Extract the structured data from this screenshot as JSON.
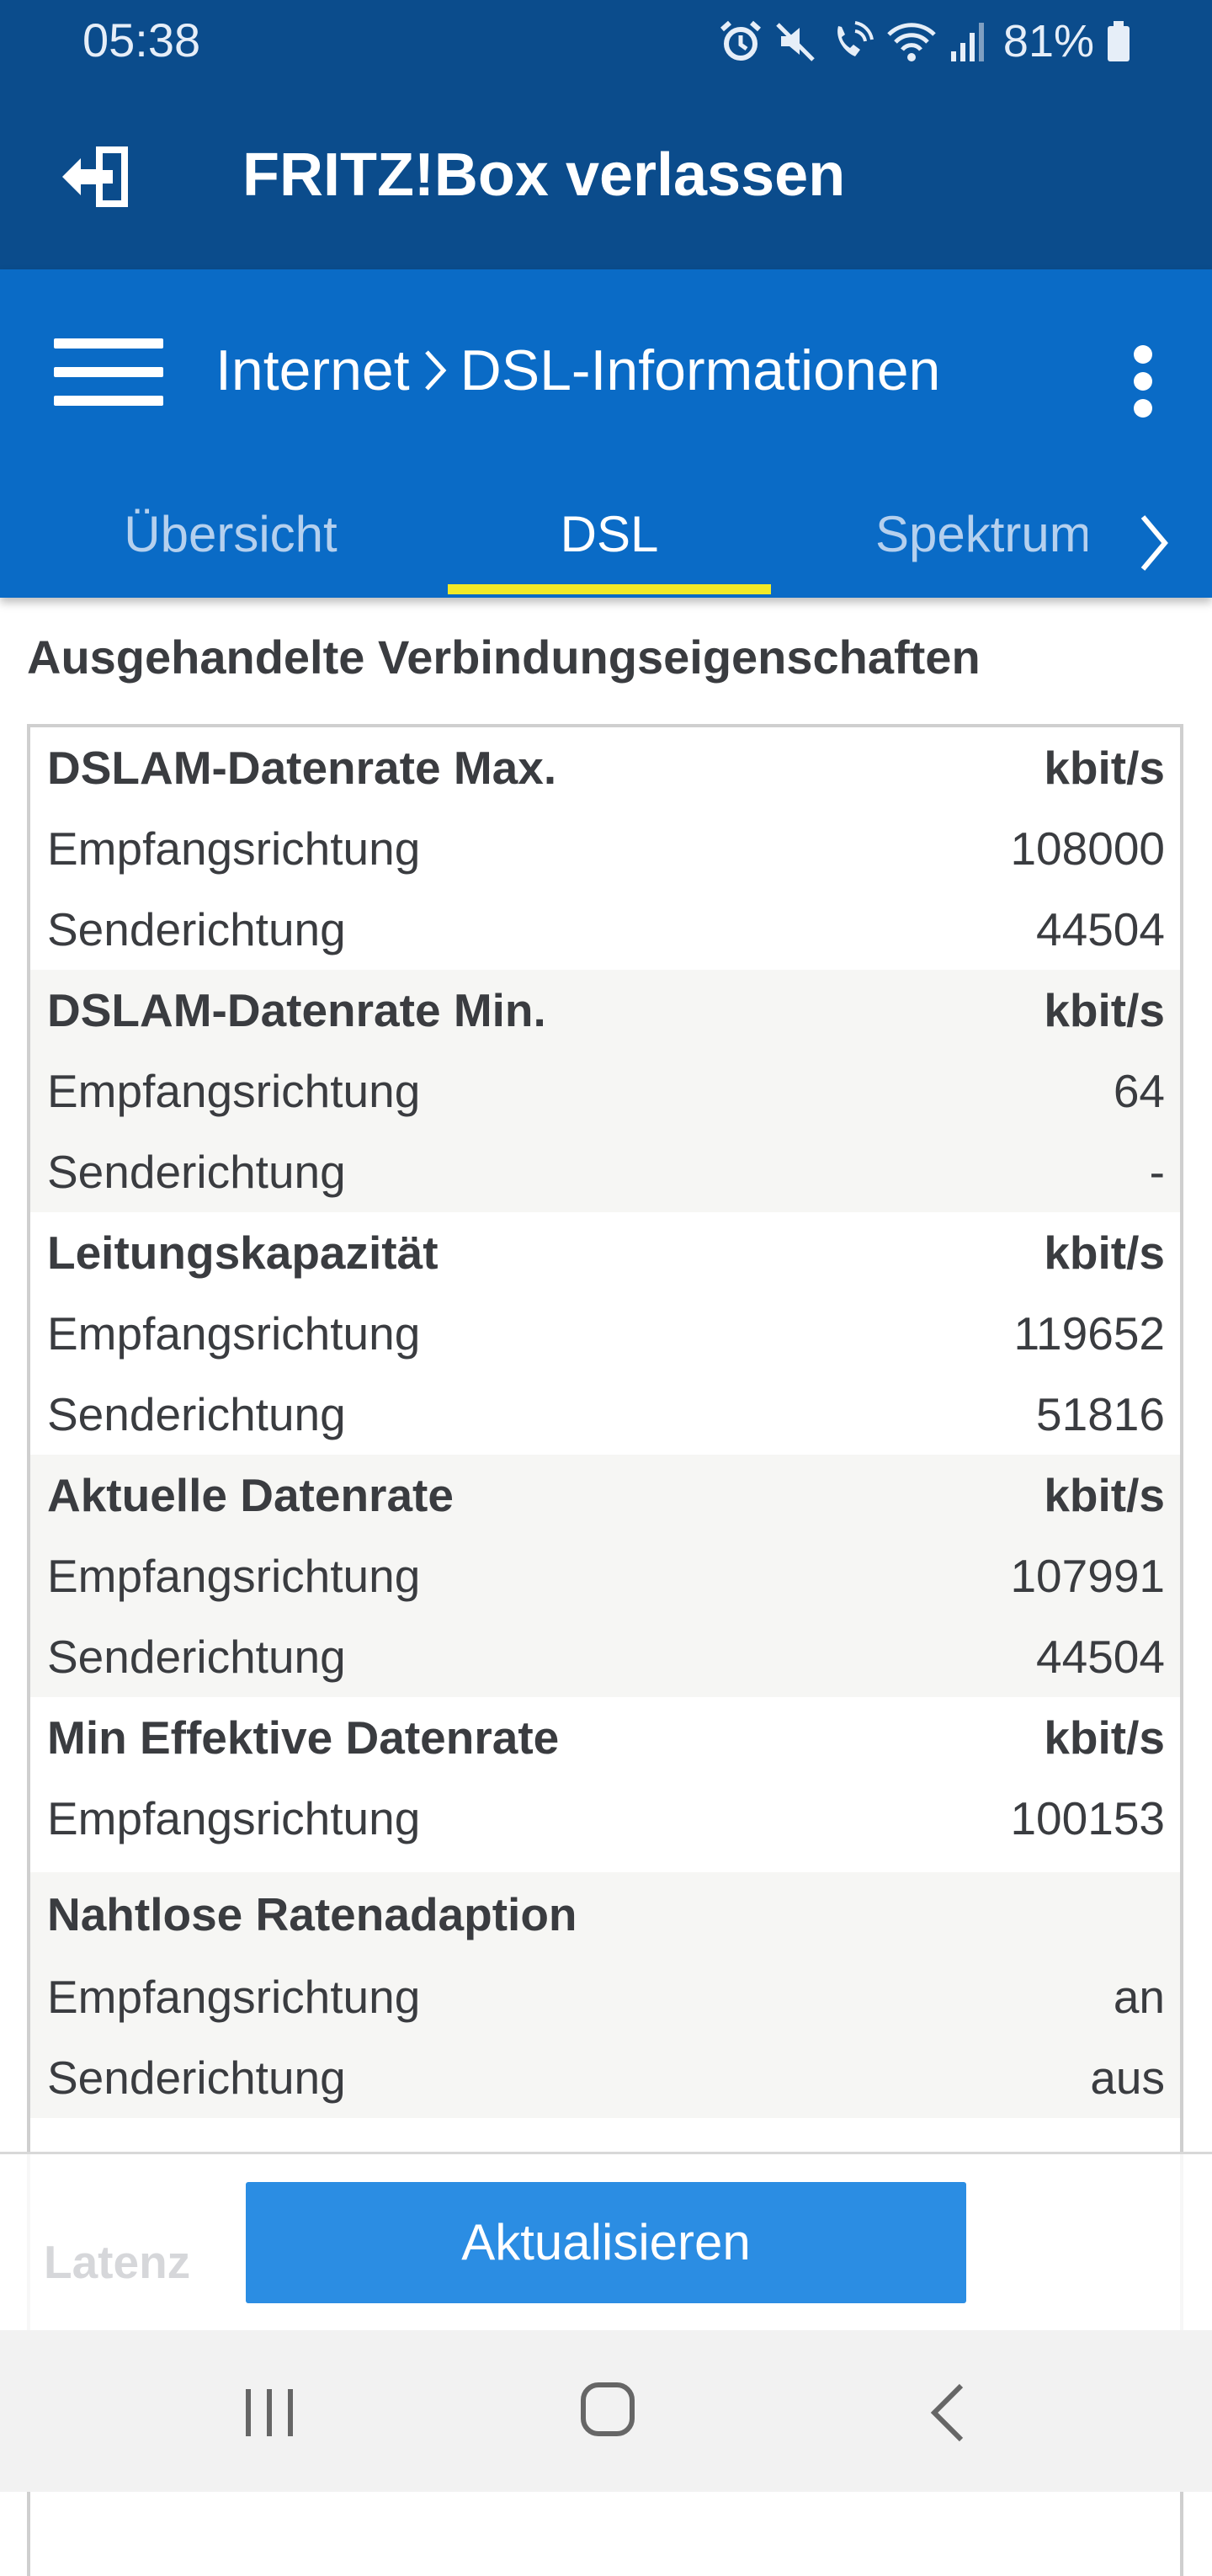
{
  "status_bar": {
    "time": "05:38",
    "battery_percent": "81%",
    "icons": [
      "alarm-icon",
      "mute-icon",
      "wifi-call-icon",
      "wifi-icon",
      "signal-icon",
      "battery-icon"
    ]
  },
  "title_bar": {
    "title": "FRITZ!Box verlassen",
    "exit_icon": "exit-icon"
  },
  "nav_bar": {
    "breadcrumb_parent": "Internet",
    "breadcrumb_current": "DSL-Informationen",
    "tabs": [
      {
        "label": "Übersicht",
        "active": false
      },
      {
        "label": "DSL",
        "active": true
      },
      {
        "label": "Spektrum",
        "active": false
      }
    ]
  },
  "section": {
    "title": "Ausgehandelte Verbindungseigenschaften"
  },
  "groups": [
    {
      "head": {
        "label": "DSLAM-Datenrate Max.",
        "unit": "kbit/s"
      },
      "rows": [
        {
          "label": "Empfangsrichtung",
          "value": "108000"
        },
        {
          "label": "Senderichtung",
          "value": "44504"
        }
      ]
    },
    {
      "head": {
        "label": "DSLAM-Datenrate Min.",
        "unit": "kbit/s"
      },
      "rows": [
        {
          "label": "Empfangsrichtung",
          "value": "64"
        },
        {
          "label": "Senderichtung",
          "value": "-"
        }
      ]
    },
    {
      "head": {
        "label": "Leitungskapazität",
        "unit": "kbit/s"
      },
      "rows": [
        {
          "label": "Empfangsrichtung",
          "value": "119652"
        },
        {
          "label": "Senderichtung",
          "value": "51816"
        }
      ]
    },
    {
      "head": {
        "label": "Aktuelle Datenrate",
        "unit": "kbit/s"
      },
      "rows": [
        {
          "label": "Empfangsrichtung",
          "value": "107991"
        },
        {
          "label": "Senderichtung",
          "value": "44504"
        }
      ]
    },
    {
      "head": {
        "label": "Min Effektive Datenrate",
        "unit": "kbit/s"
      },
      "rows": [
        {
          "label": "Empfangsrichtung",
          "value": "100153"
        }
      ]
    },
    {
      "head": {
        "label": "Nahtlose Ratenadaption",
        "unit": ""
      },
      "rows": [
        {
          "label": "Empfangsrichtung",
          "value": "an"
        },
        {
          "label": "Senderichtung",
          "value": "aus"
        }
      ]
    }
  ],
  "faded": {
    "latency_label": "Latenz"
  },
  "refresh_button": "Aktualisieren",
  "colors": {
    "title_bar": "#0b4c8c",
    "nav_bar": "#0a6bc6",
    "tab_indicator": "#f2ea28",
    "button": "#2b8de3"
  }
}
